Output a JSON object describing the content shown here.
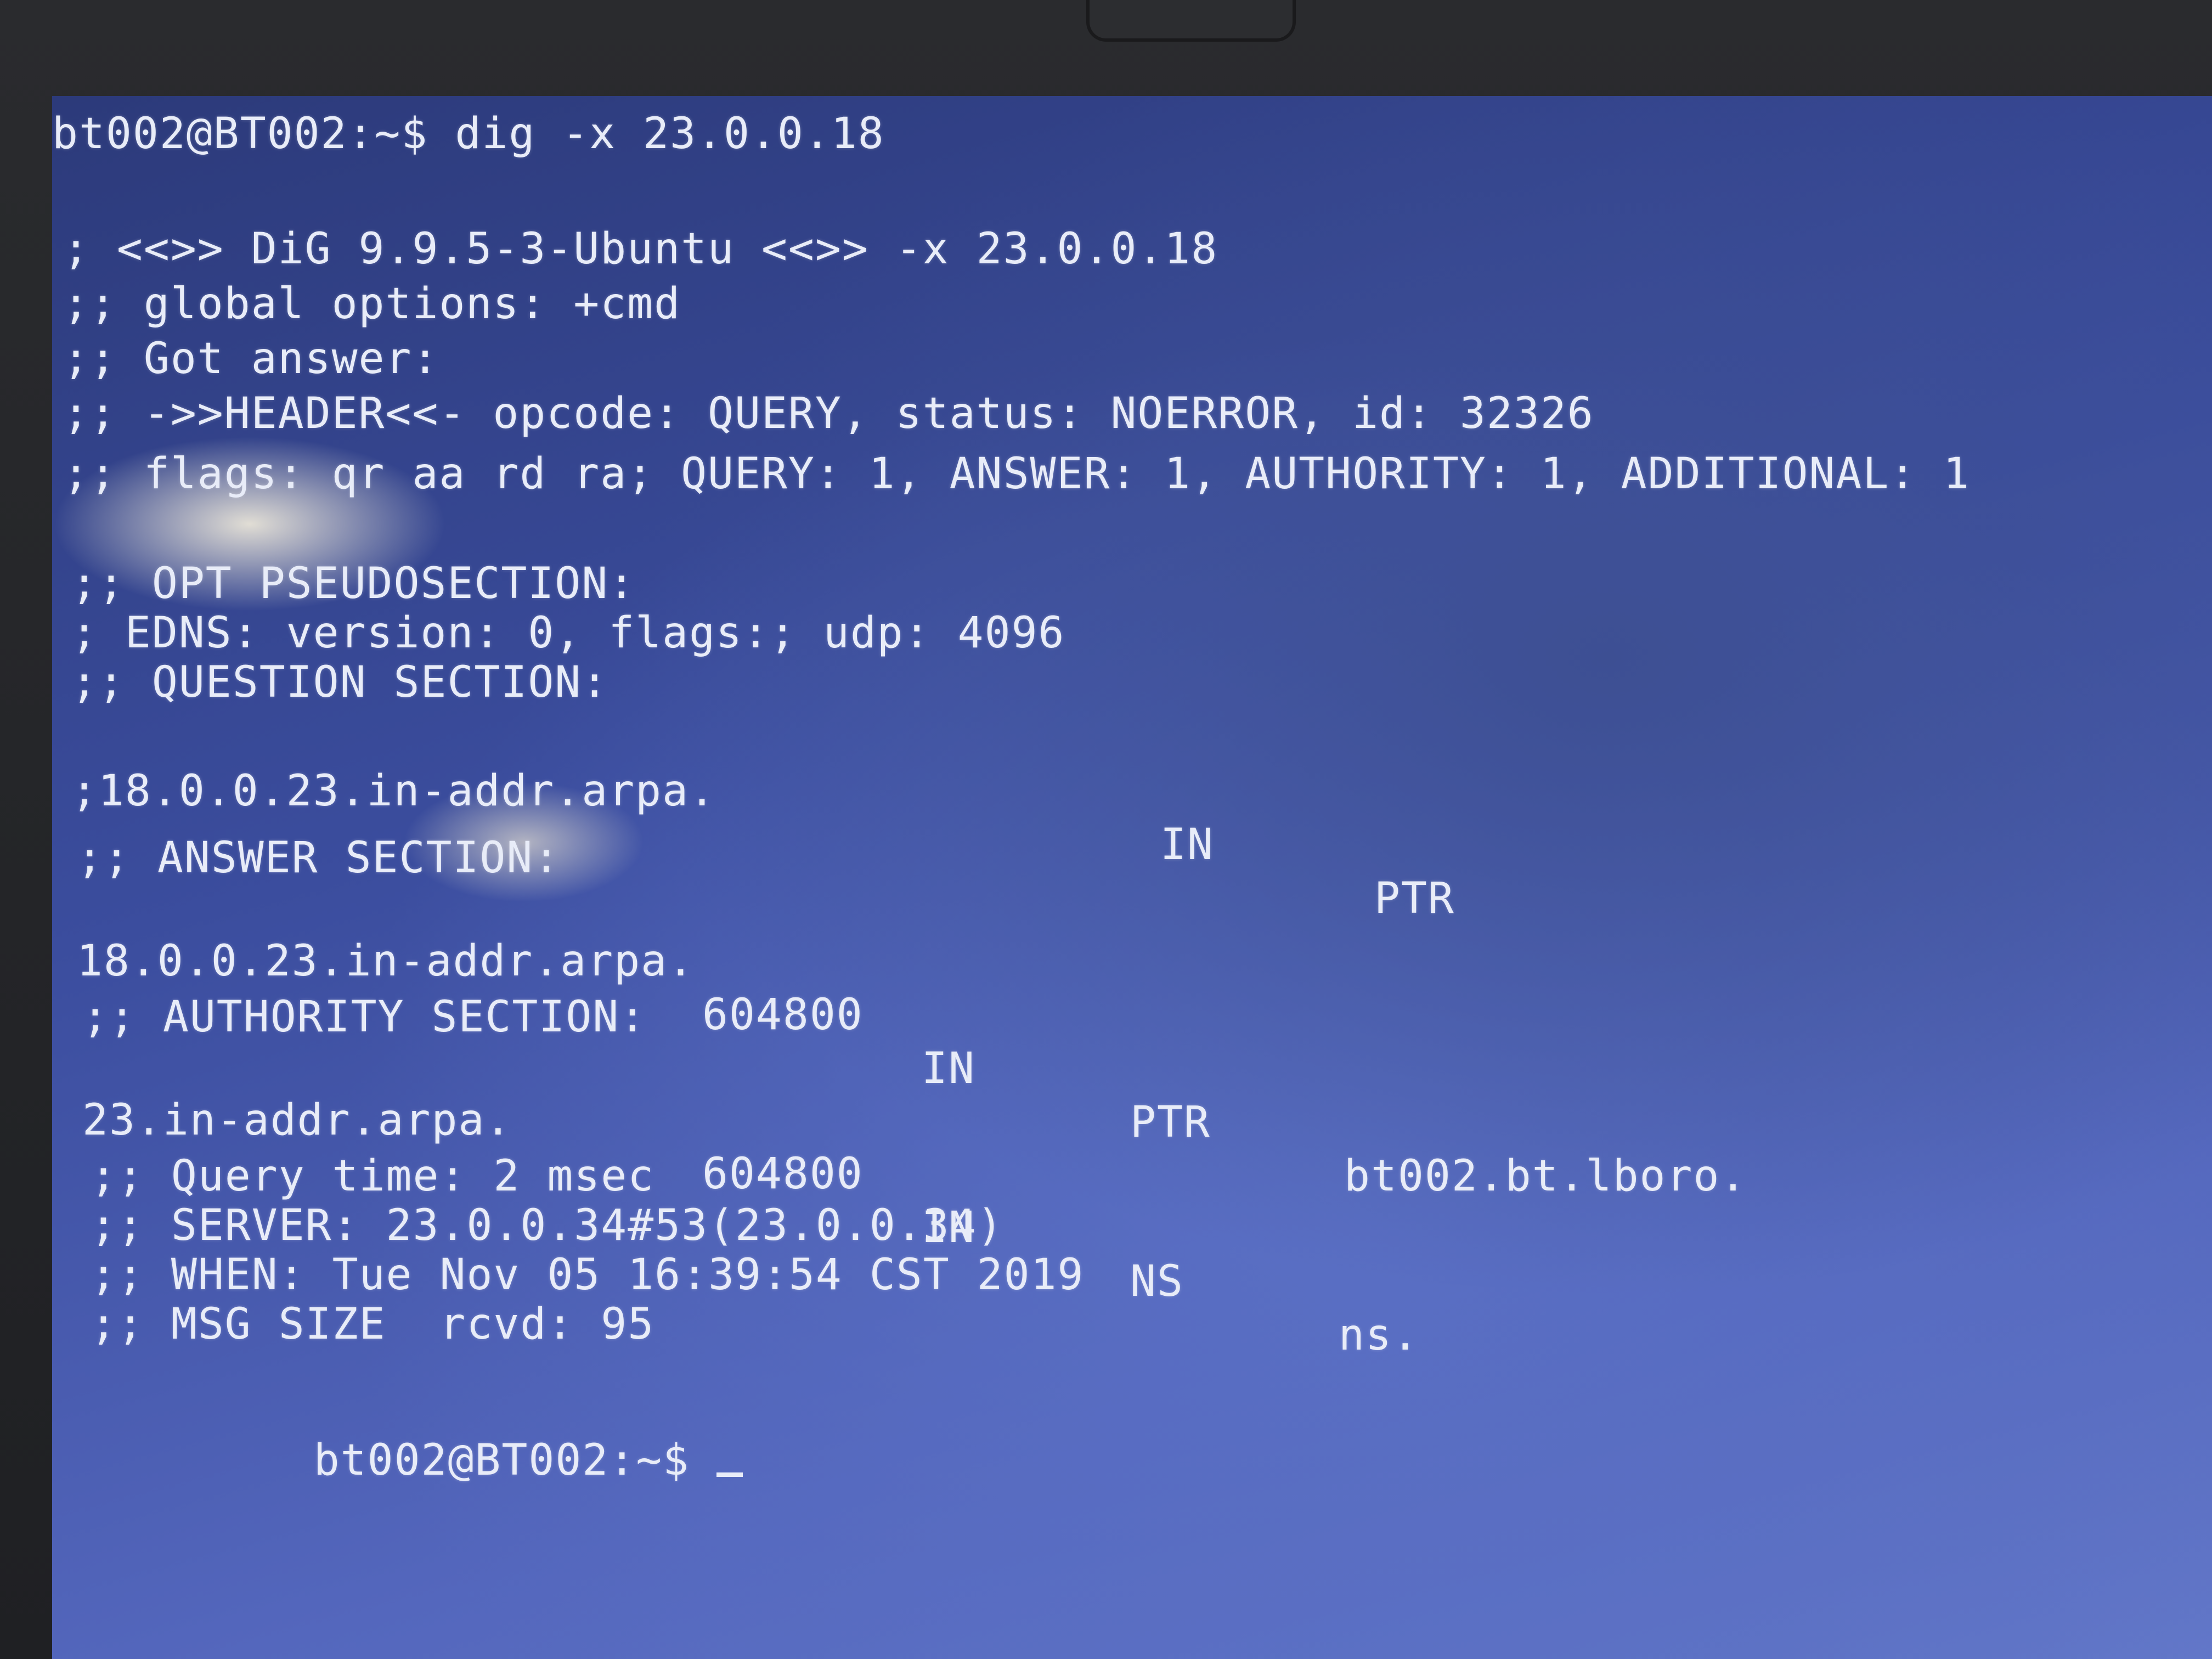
{
  "terminal": {
    "command_prompt": "bt002@BT002:~$ dig -x 23.0.0.18",
    "banner": "; <<>> DiG 9.9.5-3-Ubuntu <<>> -x 23.0.0.18",
    "global_options": ";; global options: +cmd",
    "got_answer": ";; Got answer:",
    "header": ";; ->>HEADER<<- opcode: QUERY, status: NOERROR, id: 32326",
    "flags": ";; flags: qr aa rd ra; QUERY: 1, ANSWER: 1, AUTHORITY: 1, ADDITIONAL: 1",
    "opt_section": ";; OPT PSEUDOSECTION:",
    "edns": "; EDNS: version: 0, flags:; udp: 4096",
    "question_section": ";; QUESTION SECTION:",
    "question": {
      "name": ";18.0.0.23.in-addr.arpa.",
      "class": "IN",
      "type": "PTR"
    },
    "answer_section": ";; ANSWER SECTION:",
    "answer": {
      "name": "18.0.0.23.in-addr.arpa.",
      "ttl": "604800",
      "class": "IN",
      "type": "PTR",
      "data": "bt002.bt.lboro."
    },
    "authority_section": ";; AUTHORITY SECTION:",
    "authority": {
      "name": "23.in-addr.arpa.",
      "ttl": "604800",
      "class": "IN",
      "type": "NS",
      "data": "ns."
    },
    "query_time": ";; Query time: 2 msec",
    "server": ";; SERVER: 23.0.0.34#53(23.0.0.34)",
    "when": ";; WHEN: Tue Nov 05 16:39:54 CST 2019",
    "msg_size": ";; MSG SIZE  rcvd: 95",
    "final_prompt": "bt002@BT002:~$ "
  }
}
